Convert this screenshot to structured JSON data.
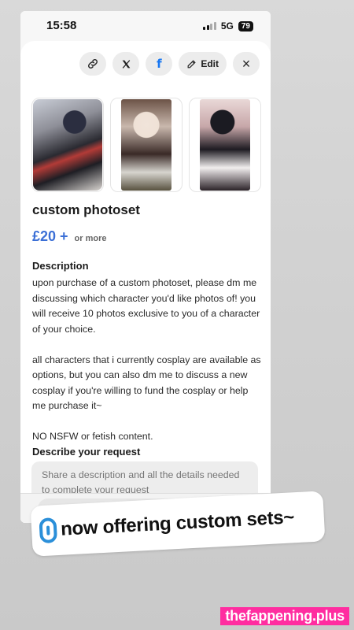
{
  "status": {
    "time": "15:58",
    "network": "5G",
    "battery": "79"
  },
  "actions": {
    "link_icon": "link-icon",
    "x_icon": "x-logo",
    "facebook_icon": "f",
    "edit_label": "Edit",
    "close_icon": "×"
  },
  "product": {
    "title": "custom photoset",
    "price": "£20 +",
    "price_note": "or more",
    "description_heading": "Description",
    "description": [
      "upon purchase of a custom photoset, please dm me discussing which character you'd like photos of! you will receive 10 photos exclusive to you of a character of your choice.",
      "all characters that i currently cosplay are available as options, but you can also dm me to discuss a new cosplay if you're willing to fund the cosplay or help me purchase it~",
      "NO NSFW or fetish content."
    ],
    "request_heading": "Describe your request",
    "request_placeholder": "Share a description and all the details needed to complete your request"
  },
  "story_caption": "now offering custom sets~",
  "watermark": "thefappening.plus",
  "colors": {
    "accent": "#3b6fd6",
    "facebook": "#1877f2",
    "watermark_bg": "#ff2da0"
  }
}
